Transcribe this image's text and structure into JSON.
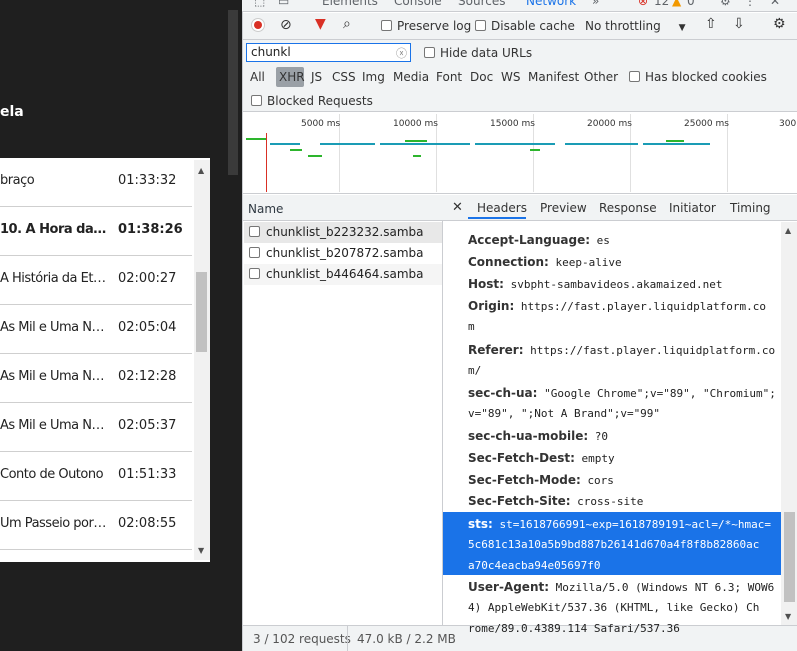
{
  "page": {
    "title_fragment": "ela",
    "rows": [
      {
        "title": "braço",
        "duration": "01:33:32",
        "bold": false
      },
      {
        "title": "10. A Hora da E…",
        "duration": "01:38:26",
        "bold": true
      },
      {
        "title": "A História da Et…",
        "duration": "02:00:27",
        "bold": false
      },
      {
        "title": "As Mil e Uma No…",
        "duration": "02:05:04",
        "bold": false
      },
      {
        "title": "As Mil e Uma No…",
        "duration": "02:12:28",
        "bold": false
      },
      {
        "title": "As Mil e Uma No…",
        "duration": "02:05:37",
        "bold": false
      },
      {
        "title": "Conto de Outono",
        "duration": "01:51:33",
        "bold": false
      },
      {
        "title": "Um Passeio por …",
        "duration": "02:08:55",
        "bold": false
      }
    ]
  },
  "devtools": {
    "top_tabs": [
      "Elements",
      "Console",
      "Sources",
      "Network",
      "»"
    ],
    "error_count": "12",
    "warning_count": "0",
    "toolbar": {
      "preserve_log": "Preserve log",
      "disable_cache": "Disable cache",
      "throttling": "No throttling"
    },
    "filter": {
      "value": "chunkl",
      "hide_data_urls": "Hide data URLs",
      "types": [
        "All",
        "XHR",
        "JS",
        "CSS",
        "Img",
        "Media",
        "Font",
        "Doc",
        "WS",
        "Manifest",
        "Other"
      ],
      "active_type": "XHR",
      "has_blocked_cookies": "Has blocked cookies",
      "blocked_requests": "Blocked Requests"
    },
    "timeline_ticks": [
      "5000 ms",
      "10000 ms",
      "15000 ms",
      "20000 ms",
      "25000 ms",
      "300"
    ],
    "name_header": "Name",
    "requests": [
      "chunklist_b223232.samba",
      "chunklist_b207872.samba",
      "chunklist_b446464.samba"
    ],
    "status": {
      "requests": "3 / 102 requests",
      "transferred": "47.0 kB / 2.2 MB"
    },
    "detail_tabs": [
      "Headers",
      "Preview",
      "Response",
      "Initiator",
      "Timing"
    ],
    "active_detail_tab": "Headers",
    "headers": [
      {
        "key": "Accept-Language:",
        "lines": [
          "es"
        ]
      },
      {
        "key": "Connection:",
        "lines": [
          "keep-alive"
        ]
      },
      {
        "key": "Host:",
        "lines": [
          "svbpht-sambavideos.akamaized.net"
        ]
      },
      {
        "key": "Origin:",
        "lines": [
          "https://fast.player.liquidplatform.co",
          "m"
        ]
      },
      {
        "key": "Referer:",
        "lines": [
          "https://fast.player.liquidplatform.co",
          "m/"
        ]
      },
      {
        "key": "sec-ch-ua:",
        "lines": [
          "\"Google Chrome\";v=\"89\", \"Chromium\";",
          "v=\"89\", \";Not A Brand\";v=\"99\""
        ]
      },
      {
        "key": "sec-ch-ua-mobile:",
        "lines": [
          "?0"
        ]
      },
      {
        "key": "Sec-Fetch-Dest:",
        "lines": [
          "empty"
        ]
      },
      {
        "key": "Sec-Fetch-Mode:",
        "lines": [
          "cors"
        ]
      },
      {
        "key": "Sec-Fetch-Site:",
        "lines": [
          "cross-site"
        ]
      }
    ],
    "selected_header": {
      "key": "sts:",
      "lines": [
        "st=1618766991~exp=1618789191~acl=/*~hmac=",
        "5c681c13a10a5b9bd887b26141d670a4f8f8b82860ac",
        "a70c4eacba94e05697f0"
      ]
    },
    "after_headers": [
      {
        "key": "User-Agent:",
        "lines": [
          "Mozilla/5.0 (Windows NT 6.3; WOW6",
          "4) AppleWebKit/537.36 (KHTML, like Gecko) Ch",
          "rome/89.0.4389.114 Safari/537.36"
        ]
      }
    ],
    "colors": {
      "accent": "#1a73e8",
      "record": "#d93025",
      "filter_icon": "#d93025"
    }
  }
}
